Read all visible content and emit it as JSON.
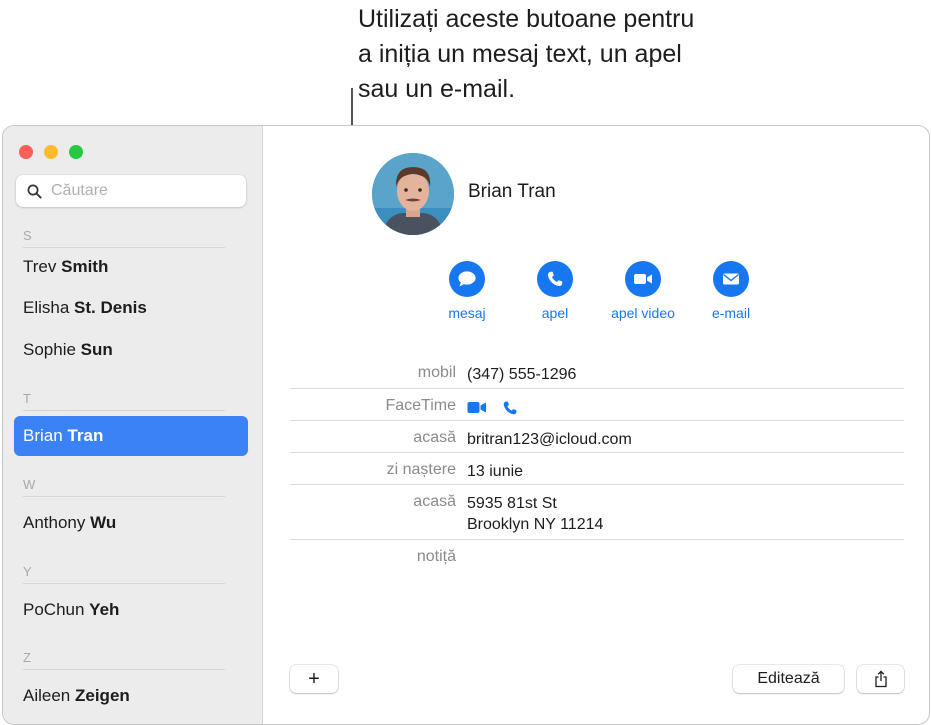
{
  "callout": {
    "lines": [
      "Utilizați aceste butoane pentru",
      "a iniția un mesaj text, un apel",
      "sau un e-mail."
    ]
  },
  "window": {
    "traffic_lights": [
      "close",
      "minimize",
      "zoom"
    ]
  },
  "sidebar": {
    "search_placeholder": "Căutare",
    "sections": [
      {
        "letter": "S",
        "contacts": [
          {
            "first": "Trev",
            "last": "Smith"
          },
          {
            "first": "Elisha",
            "last": "St. Denis"
          },
          {
            "first": "Sophie",
            "last": "Sun"
          }
        ]
      },
      {
        "letter": "T",
        "contacts": [
          {
            "first": "Brian",
            "last": "Tran"
          }
        ]
      },
      {
        "letter": "W",
        "contacts": [
          {
            "first": "Anthony",
            "last": "Wu"
          }
        ]
      },
      {
        "letter": "Y",
        "contacts": [
          {
            "first": "PoChun",
            "last": "Yeh"
          }
        ]
      },
      {
        "letter": "Z",
        "contacts": [
          {
            "first": "Aileen",
            "last": "Zeigen"
          }
        ]
      }
    ],
    "selected_contact": "Brian Tran"
  },
  "contact_card": {
    "name": "Brian Tran",
    "actions": [
      {
        "label": "mesaj",
        "icon": "message-bubble-icon"
      },
      {
        "label": "apel",
        "icon": "phone-icon"
      },
      {
        "label": "apel video",
        "icon": "video-camera-icon"
      },
      {
        "label": "e-mail",
        "icon": "envelope-icon"
      }
    ],
    "fields": [
      {
        "label": "mobil",
        "value": "(347) 555-1296"
      },
      {
        "label": "FaceTime",
        "icons": [
          "facetime-video-icon",
          "facetime-audio-icon"
        ]
      },
      {
        "label": "acasă",
        "value": "britran123@icloud.com"
      },
      {
        "label": "zi naștere",
        "value": "13 iunie"
      },
      {
        "label": "acasă",
        "value_lines": [
          "5935 81st St",
          "Brooklyn NY 11214"
        ]
      },
      {
        "label": "notiță",
        "value": ""
      }
    ]
  },
  "toolbar": {
    "add_label": "+",
    "edit_label": "Editează",
    "share_icon": "share-icon"
  },
  "colors": {
    "accent": "#1677f0",
    "selection": "#3b82f6",
    "sidebar_bg": "#ececec"
  }
}
